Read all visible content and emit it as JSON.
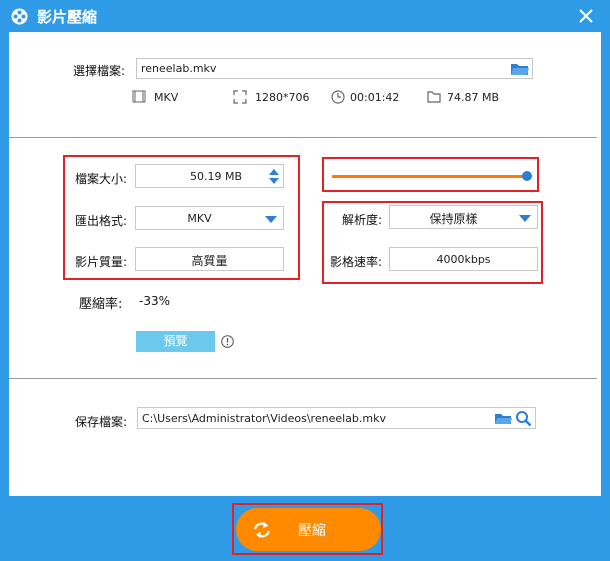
{
  "window": {
    "title": "影片壓縮",
    "colors": {
      "titlebar": "#2f9be6",
      "accent": "#ff8a00",
      "highlight": "#e1222b",
      "slider": "#ff7a00",
      "slider_knob": "#2c7ed6"
    }
  },
  "source": {
    "label": "選擇檔案:",
    "path": "reneelab.mkv",
    "format": "MKV",
    "resolution": "1280*706",
    "duration": "00:01:42",
    "size": "74.87 MB"
  },
  "settings": {
    "file_size_label": "檔案大小:",
    "file_size_value": "50.19 MB",
    "export_format_label": "匯出格式:",
    "export_format_value": "MKV",
    "quality_label": "影片質量:",
    "quality_value": "高質量",
    "slider_level": 1.0,
    "resolution_label": "解析度:",
    "resolution_value": "保持原樣",
    "bitrate_label": "影格速率:",
    "bitrate_value": "4000kbps"
  },
  "compression": {
    "ratio_label": "壓縮率:",
    "ratio_value": "-33%",
    "preview_label": "預覽"
  },
  "output": {
    "label": "保存檔案:",
    "path": "C:\\Users\\Administrator\\Videos\\reneelab.mkv"
  },
  "footer": {
    "compress_label": "壓縮"
  }
}
